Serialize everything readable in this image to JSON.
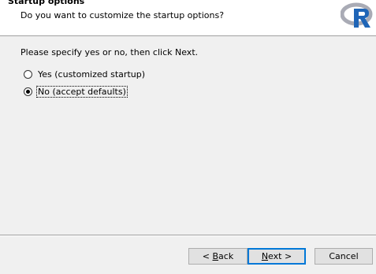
{
  "header": {
    "title": "Startup options",
    "subtitle": "Do you want to customize the startup options?",
    "logo_icon": "r-logo-icon",
    "logo_colors": {
      "ring": "#a9abb5",
      "letter": "#1f65b7"
    }
  },
  "body": {
    "prompt": "Please specify yes or no, then click Next.",
    "options": [
      {
        "label": "Yes (customized startup)",
        "checked": false
      },
      {
        "label": "No (accept defaults)",
        "checked": true,
        "focused": true
      }
    ]
  },
  "buttons": {
    "back": {
      "prefix": "< ",
      "mnemonic": "B",
      "rest": "ack"
    },
    "next": {
      "mnemonic": "N",
      "rest": "ext >"
    },
    "cancel": "Cancel"
  }
}
